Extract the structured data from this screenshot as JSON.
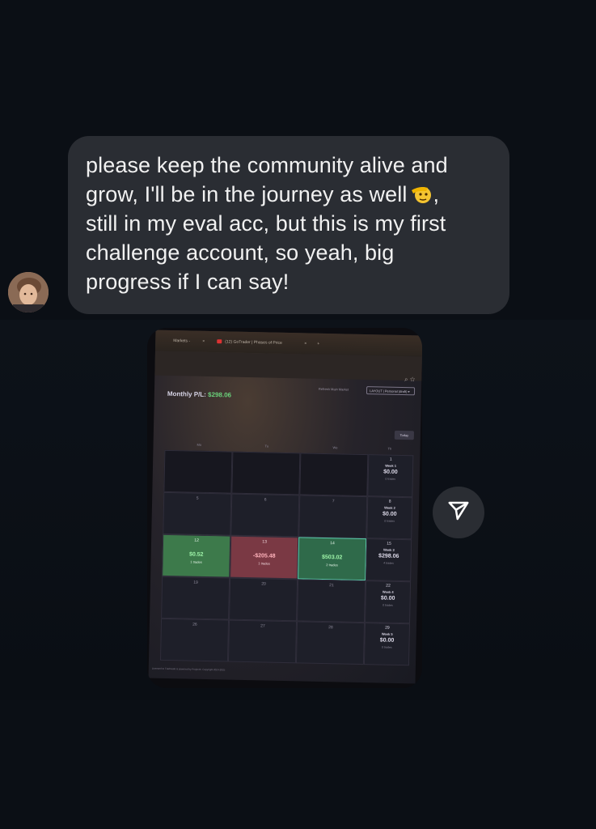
{
  "message": {
    "lines": [
      "please keep the community alive and",
      "grow, I'll be in the journey as well",
      "still in my eval acc, but this is my first",
      "challenge account, so yeah, big",
      "progress if I can say!"
    ],
    "emoji_after_line2": "saluting-face-emoji",
    "line2_suffix": ","
  },
  "colors": {
    "background": "#0b0f15",
    "bubble": "#2a2d33",
    "text": "#f1f1f1",
    "profit_green": "#6ad07a",
    "loss_red": "#7a3944"
  },
  "photo": {
    "browser": {
      "tab1": "Markets -",
      "tab1_close": "×",
      "tab2": "(12) GoTrader | Phases of Price",
      "tab2_close": "×",
      "new_tab": "+",
      "toolbar_icons": "⌕ ☆"
    },
    "header": {
      "monthly_label": "Monthly P/L:",
      "monthly_value": "$298.06",
      "alerts_text": "Refresh Main Market",
      "layout_dropdown": "LAYOUT | Personal (draft) ▾"
    },
    "today_button": "Today",
    "weekdays": [
      "Mo",
      "Tu",
      "We",
      "Th",
      "Fr"
    ],
    "rows": [
      {
        "days": [
          {
            "day": "",
            "amount": "",
            "trades": "",
            "style": "dim"
          },
          {
            "day": "",
            "amount": "",
            "trades": "",
            "style": "dim"
          },
          {
            "day": "",
            "amount": "",
            "trades": "",
            "style": "dim"
          }
        ],
        "week": {
          "day": "1",
          "label": "Week 1",
          "value": "$0.00",
          "trades": "0 trades"
        }
      },
      {
        "days": [
          {
            "day": "5",
            "amount": "",
            "trades": "",
            "style": "plain"
          },
          {
            "day": "6",
            "amount": "",
            "trades": "",
            "style": "plain"
          },
          {
            "day": "7",
            "amount": "",
            "trades": "",
            "style": "plain"
          }
        ],
        "week": {
          "day": "8",
          "label": "Week 2",
          "value": "$0.00",
          "trades": "0 trades"
        }
      },
      {
        "days": [
          {
            "day": "12",
            "amount": "$0.52",
            "trades": "1 trades",
            "style": "green"
          },
          {
            "day": "13",
            "amount": "-$205.48",
            "trades": "1 trades",
            "style": "red"
          },
          {
            "day": "14",
            "amount": "$503.02",
            "trades": "2 trades",
            "style": "green2"
          }
        ],
        "week": {
          "day": "15",
          "label": "Week 3",
          "value": "$298.06",
          "trades": "4 trades"
        }
      },
      {
        "days": [
          {
            "day": "19",
            "amount": "",
            "trades": "",
            "style": "plain"
          },
          {
            "day": "20",
            "amount": "",
            "trades": "",
            "style": "plain"
          },
          {
            "day": "21",
            "amount": "",
            "trades": "",
            "style": "plain"
          }
        ],
        "week": {
          "day": "22",
          "label": "Week 4",
          "value": "$0.00",
          "trades": "0 trades"
        }
      },
      {
        "days": [
          {
            "day": "26",
            "amount": "",
            "trades": "",
            "style": "plain"
          },
          {
            "day": "27",
            "amount": "",
            "trades": "",
            "style": "plain"
          },
          {
            "day": "28",
            "amount": "",
            "trades": "",
            "style": "plain"
          }
        ],
        "week": {
          "day": "29",
          "label": "Week 5",
          "value": "$0.00",
          "trades": "0 trades"
        }
      }
    ],
    "footer": "Licensed to Tradovate & powered by ProjectX. Copyright 2024-2025"
  },
  "share_icon": "paper-plane-icon"
}
